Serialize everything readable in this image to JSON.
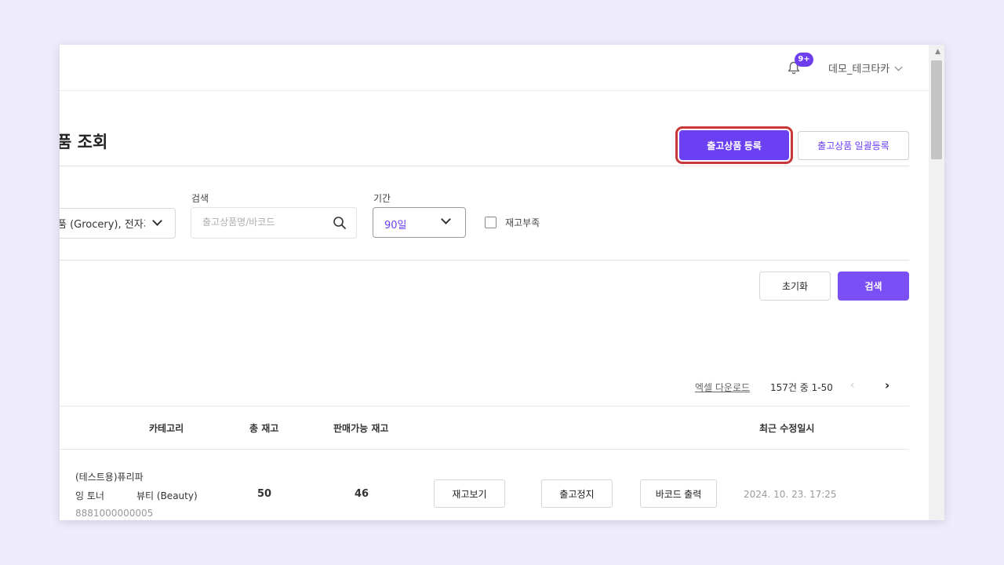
{
  "header": {
    "notification_badge": "9+",
    "user_name": "데모_테크타카"
  },
  "page": {
    "title": "품 조회",
    "register_button": "출고상품 등록",
    "bulk_register_button": "출고상품 일괄등록"
  },
  "filters": {
    "category_value": "품 (Grocery), 전자기",
    "search_label": "검색",
    "search_placeholder": "출고상품명/바코드",
    "period_label": "기간",
    "period_value": "90일",
    "out_of_stock_label": "재고부족",
    "reset_button": "초기화",
    "search_button": "검색"
  },
  "results": {
    "excel_download": "엑셀 다운로드",
    "range_text": "157건 중 1-50",
    "prev": "‹",
    "next": "›"
  },
  "table": {
    "columns": [
      "카테고리",
      "총 재고",
      "판매가능 재고",
      "최근 수정일시"
    ],
    "rows": [
      {
        "name_line1": "(테스트용)퓨리파",
        "name_line2": "잉 토너",
        "barcode": "8881000000005",
        "category": "뷰티 (Beauty)",
        "total_stock": "50",
        "available_stock": "46",
        "btn_stock": "재고보기",
        "btn_stop": "출고정지",
        "btn_barcode": "바코드 출력",
        "updated_at": "2024. 10. 23. 17:25"
      }
    ]
  },
  "colors": {
    "accent": "#6b3ff2",
    "highlight_outline": "#c8383a",
    "background": "#eeecfa"
  }
}
